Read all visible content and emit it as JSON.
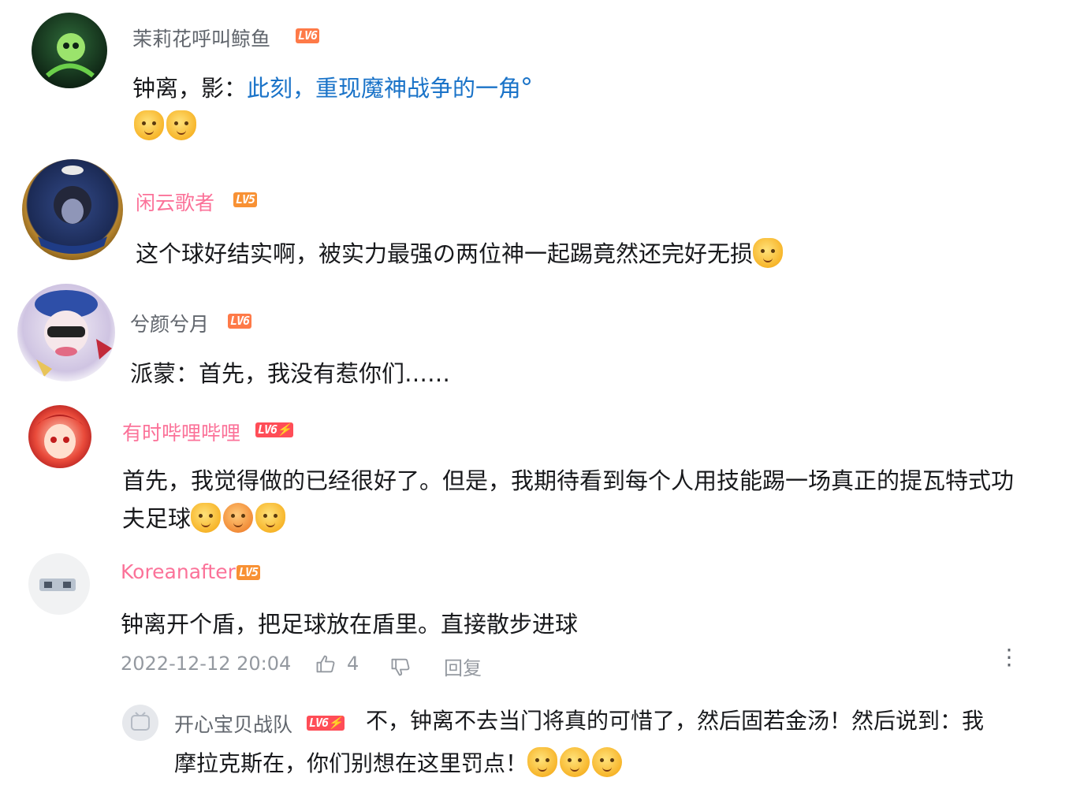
{
  "comments": [
    {
      "username": "茉莉花呼叫鲸鱼",
      "level": "LV6",
      "text_plain": "钟离，影：",
      "text_link": "此刻，重现魔神战争的一角",
      "name_color": "#61666d",
      "emojis": [
        "cat-emoji",
        "cat-emoji"
      ]
    },
    {
      "username": "闲云歌者",
      "level": "LV5",
      "text": "这个球好结实啊，被实力最强の两位神一起踢竟然还完好无损",
      "name_color": "#fb7299",
      "emojis": [
        "cat-emoji"
      ]
    },
    {
      "username": "兮颜兮月",
      "level": "LV6",
      "text": "派蒙：首先，我没有惹你们……",
      "name_color": "#61666d"
    },
    {
      "username": "有时哔哩哔哩",
      "level": "LV6⚡",
      "text_line1": "首先，我觉得做的已经很好了。但是，我期待看到每个人用技能踢一场真正的提瓦特式功",
      "text_line2": "夫足球",
      "name_color": "#fb7299",
      "emojis": [
        "cat-emoji",
        "blush-emoji",
        "cat-emoji"
      ]
    },
    {
      "username": "Koreanafter",
      "level": "LV5",
      "text": "钟离开个盾，把足球放在盾里。直接散步进球",
      "name_color": "#fb7299",
      "timestamp": "2022-12-12 20:04",
      "likes": "4",
      "reply_label": "回复"
    }
  ],
  "reply": {
    "username": "开心宝贝战队",
    "level": "LV6⚡",
    "text_line1": "不，钟离不去当门将真的可惜了，然后固若金汤！然后说到：我",
    "text_line2": "摩拉克斯在，你们别想在这里罚点！",
    "emojis": [
      "cat-emoji",
      "grin-emoji",
      "tongue-emoji"
    ]
  },
  "colors": {
    "link": "#1a73c8",
    "meta": "#9499a0",
    "pink": "#fb7299"
  }
}
